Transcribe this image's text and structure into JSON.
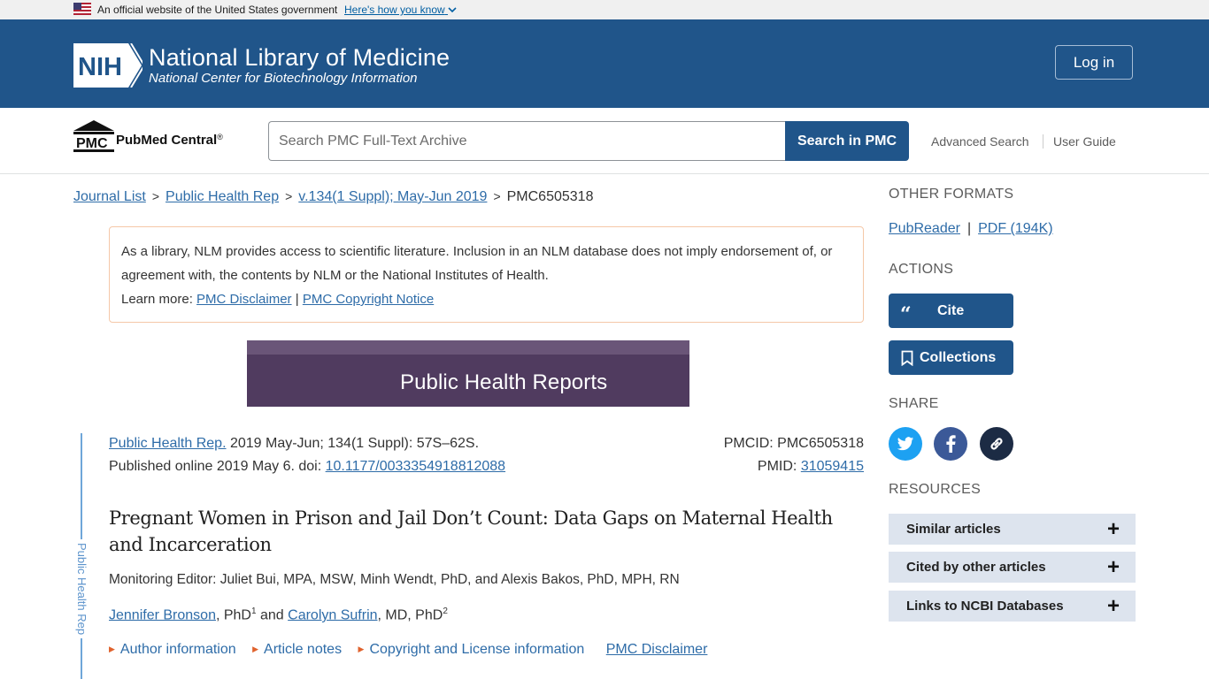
{
  "gov_banner": {
    "text": "An official website of the United States government",
    "link": "Here's how you know"
  },
  "header": {
    "nih_logo_text": "NIH",
    "title": "National Library of Medicine",
    "subtitle": "National Center for Biotechnology Information",
    "login_label": "Log in"
  },
  "pmc_bar": {
    "logo_short": "PMC",
    "logo_text": "PubMed Central",
    "logo_reg": "®",
    "search_placeholder": "Search PMC Full-Text Archive",
    "search_button": "Search in PMC",
    "advanced_search": "Advanced Search",
    "user_guide": "User Guide"
  },
  "breadcrumb": {
    "items": [
      "Journal List",
      "Public Health Rep",
      "v.134(1 Suppl); May-Jun 2019"
    ],
    "separator": ">",
    "current": "PMC6505318"
  },
  "disclaimer": {
    "text": "As a library, NLM provides access to scientific literature. Inclusion in an NLM database does not imply endorsement of, or agreement with, the contents by NLM or the National Institutes of Health.",
    "learn_more": "Learn more:",
    "link1": "PMC Disclaimer",
    "divider": "|",
    "link2": "PMC Copyright Notice"
  },
  "journal_banner": {
    "title": "Public Health Reports"
  },
  "side_label": "Public Health Rep",
  "citation": {
    "journal_link": "Public Health Rep.",
    "details": " 2019 May-Jun; 134(1 Suppl): 57S–62S.",
    "published": "Published online 2019 May 6. doi: ",
    "doi": "10.1177/0033354918812088",
    "pmcid": "PMCID: PMC6505318",
    "pmid_label": "PMID: ",
    "pmid": "31059415"
  },
  "article": {
    "title": "Pregnant Women in Prison and Jail Don’t Count: Data Gaps on Maternal Health and Incarceration",
    "monitoring_editor": "Monitoring Editor: Juliet Bui, MPA, MSW, Minh Wendt, PhD, and Alexis Bakos, PhD, MPH, RN",
    "author1": "Jennifer Bronson",
    "author1_degree": ", PhD",
    "author1_sup": "1",
    "and": " and ",
    "author2": "Carolyn Sufrin",
    "author2_degree": ", MD, PhD",
    "author2_sup": "2",
    "links": [
      "Author information",
      "Article notes",
      "Copyright and License information"
    ],
    "disclaimer_link": "PMC Disclaimer"
  },
  "sidebar": {
    "other_formats_heading": "OTHER FORMATS",
    "pubreader": "PubReader",
    "pdf": "PDF (194K)",
    "actions_heading": "ACTIONS",
    "cite": "Cite",
    "collections": "Collections",
    "share_heading": "SHARE",
    "resources_heading": "RESOURCES",
    "resources": [
      "Similar articles",
      "Cited by other articles",
      "Links to NCBI Databases"
    ]
  },
  "colors": {
    "header_blue": "#20558a",
    "link_blue": "#2e6ca8",
    "journal_purple": "#503b5f",
    "twitter": "#1da1f2",
    "facebook": "#3b5998",
    "link_share": "#1c2b44",
    "resource_bg": "#dde4ee"
  }
}
